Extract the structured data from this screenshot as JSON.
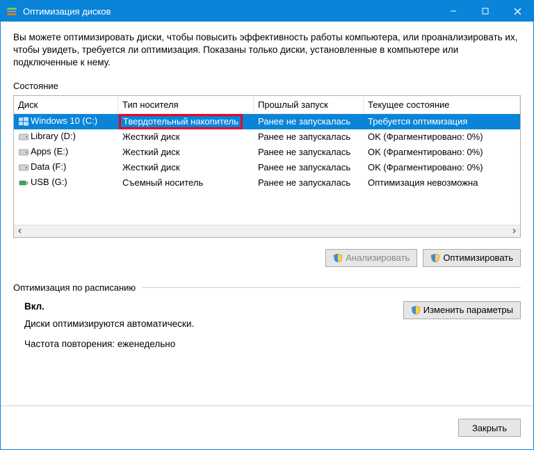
{
  "window": {
    "title": "Оптимизация дисков"
  },
  "description": "Вы можете оптимизировать диски, чтобы повысить эффективность работы  компьютера, или проанализировать их, чтобы увидеть, требуется ли оптимизация. Показаны только диски, установленные в компьютере или подключенные к нему.",
  "status_label": "Состояние",
  "columns": {
    "disk": "Диск",
    "type": "Тип носителя",
    "last": "Прошлый запуск",
    "state": "Текущее состояние"
  },
  "rows": [
    {
      "icon": "win",
      "disk": "Windows 10 (C:)",
      "type": "Твердотельный накопитель",
      "last": "Ранее не запускалась",
      "state": "Требуется оптимизация",
      "selected": true,
      "hl_type": true
    },
    {
      "icon": "hdd",
      "disk": "Library (D:)",
      "type": "Жесткий диск",
      "last": "Ранее не запускалась",
      "state": "OK (Фрагментировано: 0%)"
    },
    {
      "icon": "hdd",
      "disk": "Apps (E:)",
      "type": "Жесткий диск",
      "last": "Ранее не запускалась",
      "state": "OK (Фрагментировано: 0%)"
    },
    {
      "icon": "hdd",
      "disk": "Data (F:)",
      "type": "Жесткий диск",
      "last": "Ранее не запускалась",
      "state": "OK (Фрагментировано: 0%)"
    },
    {
      "icon": "usb",
      "disk": "USB (G:)",
      "type": "Съемный носитель",
      "last": "Ранее не запускалась",
      "state": "Оптимизация невозможна"
    }
  ],
  "buttons": {
    "analyze": "Анализировать",
    "optimize": "Оптимизировать",
    "change_settings": "Изменить параметры",
    "close": "Закрыть"
  },
  "schedule": {
    "header": "Оптимизация по расписанию",
    "on": "Вкл.",
    "auto": "Диски оптимизируются автоматически.",
    "freq": "Частота повторения: еженедельно"
  }
}
